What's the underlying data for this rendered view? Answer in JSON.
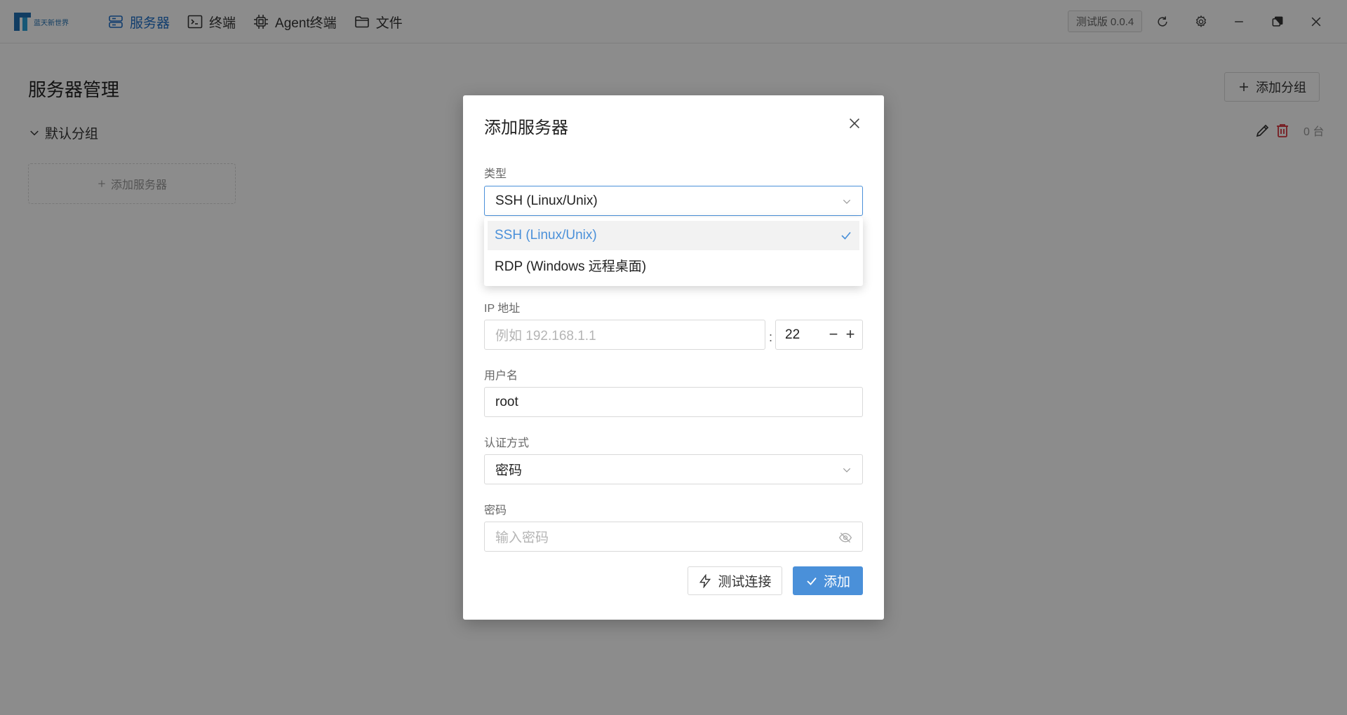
{
  "app": {
    "logo_text": "蓝天新世界",
    "nav": [
      {
        "label": "服务器",
        "active": true
      },
      {
        "label": "终端",
        "active": false
      },
      {
        "label": "Agent终端",
        "active": false
      },
      {
        "label": "文件",
        "active": false
      }
    ],
    "version": "测试版 0.0.4"
  },
  "page": {
    "title": "服务器管理",
    "add_group_label": "添加分组",
    "group_name": "默认分组",
    "group_count": "0 台",
    "add_server_label": "添加服务器"
  },
  "modal": {
    "title": "添加服务器",
    "type_label": "类型",
    "type_value": "SSH (Linux/Unix)",
    "type_options": [
      {
        "label": "SSH (Linux/Unix)",
        "selected": true
      },
      {
        "label": "RDP (Windows 远程桌面)",
        "selected": false
      }
    ],
    "ip_label": "IP 地址",
    "ip_placeholder": "例如 192.168.1.1",
    "port_value": "22",
    "username_label": "用户名",
    "username_value": "root",
    "auth_label": "认证方式",
    "auth_value": "密码",
    "password_label": "密码",
    "password_placeholder": "输入密码",
    "test_button": "测试连接",
    "add_button": "添加"
  },
  "colors": {
    "accent": "#4a90d9",
    "active_nav": "#1e6fc9",
    "delete_icon": "#d9363e"
  }
}
